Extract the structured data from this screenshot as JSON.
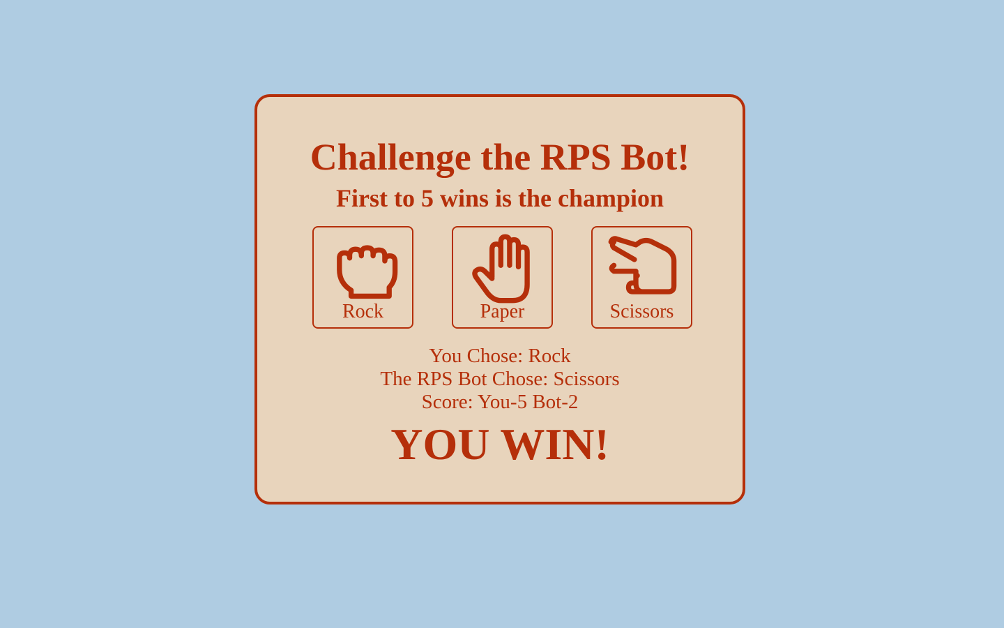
{
  "theme": {
    "background": "#afcce2",
    "card_background": "#e8d4bc",
    "accent": "#b52f0a"
  },
  "game": {
    "title": "Challenge the RPS Bot!",
    "subtitle": "First to 5 wins is the champion"
  },
  "choices": [
    {
      "label": "Rock",
      "icon": "fist-icon"
    },
    {
      "label": "Paper",
      "icon": "open-hand-icon"
    },
    {
      "label": "Scissors",
      "icon": "scissors-hand-icon"
    }
  ],
  "result": {
    "you_chose": "You Chose: Rock",
    "bot_chose": "The RPS Bot Chose: Scissors",
    "score": "Score: You-5 Bot-2",
    "outcome": "YOU WIN!"
  }
}
